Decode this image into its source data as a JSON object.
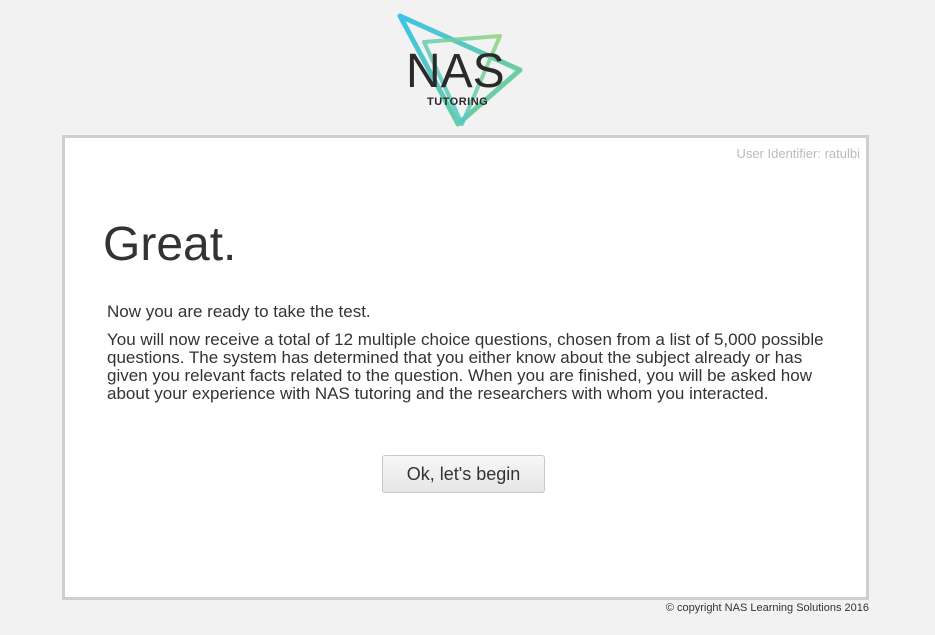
{
  "logo": {
    "main_text": "NAS",
    "sub_text": "TUTORING",
    "colors": {
      "triangle_blue": "#3ec3e6",
      "triangle_green": "#7ccf8a",
      "text": "#2a2a2a"
    }
  },
  "panel": {
    "user_identifier": "User Identifier: ratulbi",
    "heading": "Great.",
    "lead": "Now you are ready to take the test.",
    "body": "You will now receive a total of 12 multiple choice questions, chosen from a list of 5,000 possible questions. The system has determined that you either know about the subject already or has given you relevant facts related to the question. When you are finished, you will be asked how about your experience with NAS tutoring and the researchers with whom you interacted.",
    "begin_button_label": "Ok, let's begin"
  },
  "footer": {
    "copyright": "© copyright NAS Learning Solutions 2016"
  }
}
